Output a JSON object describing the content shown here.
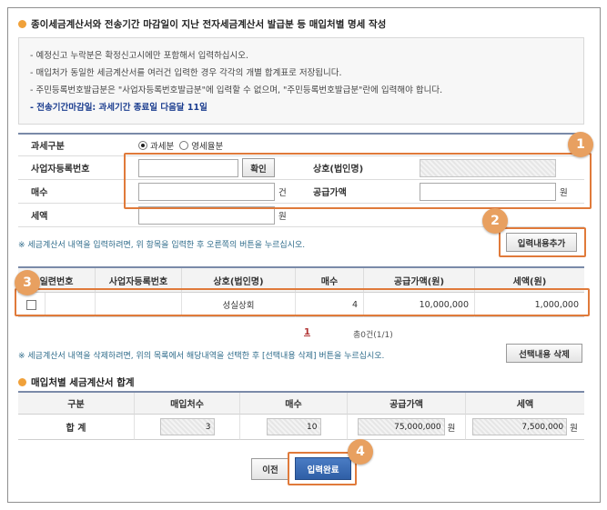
{
  "title": "종이세금계산서와 전송기간 마감일이 지난 전자세금계산서 발급분 등 매입처별 명세 작성",
  "notice": {
    "lines": [
      "- 예정신고 누락분은 확정신고시에만 포함해서 입력하십시오.",
      "- 매입처가 동일한 세금계산서를 여러건 입력한 경우 각각의 개별 합계표로 저장됩니다.",
      "- 주민등록번호발급분은 \"사업자등록번호발급분\"에 입력할 수 없으며, \"주민등록번호발급분\"란에 입력해야 합니다."
    ],
    "deadline": "- 전송기간마감일: 과세기간 종료일 다음달 11일"
  },
  "form": {
    "tax_type_label": "과세구분",
    "radio_taxable": "과세분",
    "radio_zero": "영세율분",
    "brn_label": "사업자등록번호",
    "confirm_btn": "확인",
    "company_label": "상호(법인명)",
    "count_label": "매수",
    "count_unit": "건",
    "supply_label": "공급가액",
    "supply_unit": "원",
    "tax_label": "세액",
    "tax_unit": "원"
  },
  "hint_add": "※ 세금계산서 내역을 입력하려면, 위 항목을 입력한 후 오른쪽의 버튼을 누르십시오.",
  "add_btn": "입력내용추가",
  "grid": {
    "headers": [
      "일련번호",
      "사업자등록번호",
      "상호(법인명)",
      "매수",
      "공급가액(원)",
      "세액(원)"
    ],
    "row": {
      "serial": "",
      "brn": "",
      "company": "성실상회",
      "count": "4",
      "supply": "10,000,000",
      "tax": "1,000,000"
    }
  },
  "pagination": {
    "page": "1",
    "total": "총0건(1/1)"
  },
  "hint_delete": "※ 세금계산서 내역을 삭제하려면, 위의 목록에서 해당내역을 선택한 후 [선택내용 삭제] 버튼을 누르십시오.",
  "delete_btn": "선택내용 삭제",
  "summary": {
    "title": "매입처별 세금계산서 합계",
    "headers": [
      "구분",
      "매입처수",
      "매수",
      "공급가액",
      "세액"
    ],
    "row_label": "합 계",
    "vendors": "3",
    "count": "10",
    "supply": "75,000,000",
    "supply_unit": "원",
    "tax": "7,500,000",
    "tax_unit": "원"
  },
  "prev_btn": "이전",
  "done_btn": "입력완료",
  "badges": [
    "1",
    "2",
    "3",
    "4"
  ],
  "colors": {
    "highlight": "#e07a3a",
    "badge": "#e8a060",
    "primary_button": "#2f5fa6"
  }
}
